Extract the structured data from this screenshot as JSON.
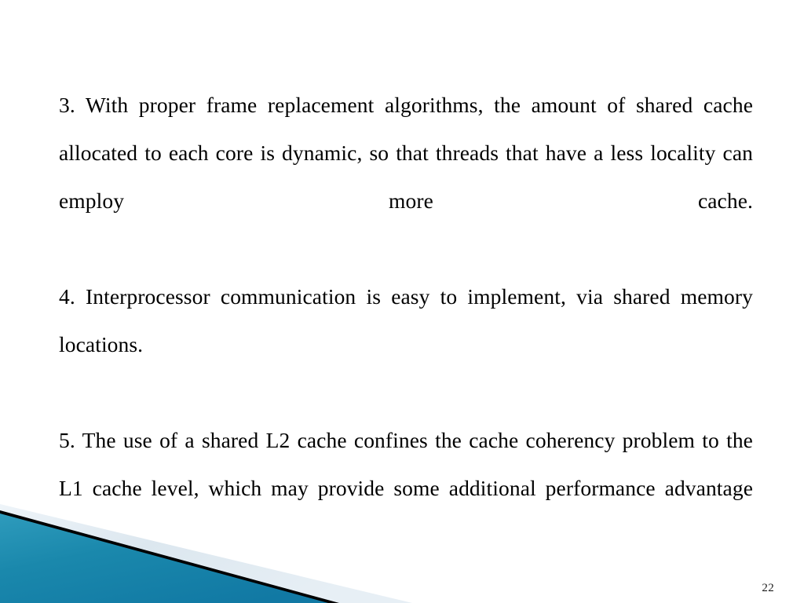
{
  "slide": {
    "background_color": "#FFFFFF",
    "page_number": "22",
    "body": {
      "paragraphs": [
        {
          "id": "item-3",
          "text": "3. With proper frame replacement algorithms, the amount of shared cache allocated to each core is dynamic, so that threads that have a less locality can employ more cache."
        },
        {
          "id": "item-4",
          "text": "4. Interprocessor communication is easy to implement, via shared memory locations."
        },
        {
          "id": "item-5",
          "text": "5. The use of a shared L2 cache confines the cache coherency problem to the L1 cache level, which may provide some additional performance advantage"
        }
      ]
    },
    "decoration": {
      "name": "bottom-left-diagonal-banner",
      "teal_color": "#1A88AC",
      "teal_color_dark": "#116E90",
      "teal_color_light": "#2E9BBC",
      "stripe_color": "#000000",
      "pale_band_color": "#DCE7EF",
      "pale_band_color_light": "#F1F6FA"
    }
  }
}
